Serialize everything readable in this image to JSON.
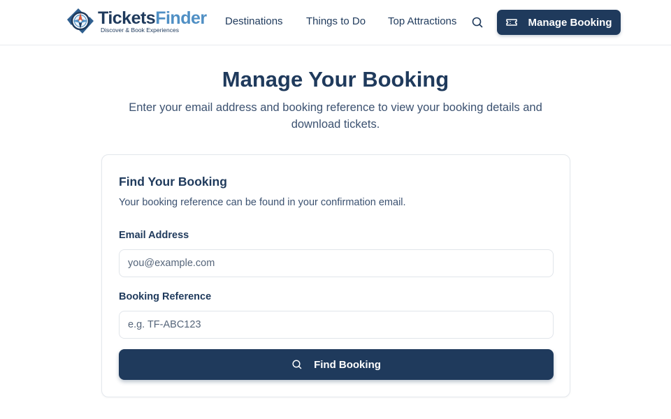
{
  "header": {
    "brand_part1": "Tickets",
    "brand_part2": "Finder",
    "tagline": "Discover & Book Experiences",
    "logo_icon": "compass-logo-icon",
    "nav": [
      {
        "label": "Destinations"
      },
      {
        "label": "Things to Do"
      },
      {
        "label": "Top Attractions"
      }
    ],
    "search_icon": "search-icon",
    "manage_booking_label": "Manage Booking",
    "manage_booking_icon": "ticket-icon"
  },
  "hero": {
    "title": "Manage Your Booking",
    "subtitle": "Enter your email address and booking reference to view your booking details and download tickets."
  },
  "form": {
    "title": "Find Your Booking",
    "description": "Your booking reference can be found in your confirmation email.",
    "email_label": "Email Address",
    "email_placeholder": "you@example.com",
    "email_value": "",
    "reference_label": "Booking Reference",
    "reference_placeholder": "e.g. TF-ABC123",
    "reference_value": "",
    "submit_label": "Find Booking",
    "submit_icon": "search-icon"
  },
  "colors": {
    "primary": "#1f3a5c",
    "accent": "#4f8fc4",
    "border": "#e3e7ec",
    "text_muted": "#3b5170"
  }
}
